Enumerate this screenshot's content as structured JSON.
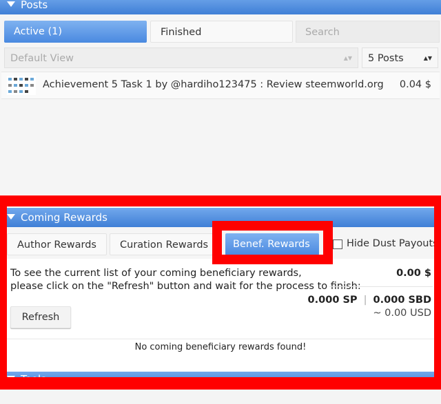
{
  "posts": {
    "header_title": "Posts",
    "tabs": [
      {
        "label": "Active (1)"
      },
      {
        "label": "Finished"
      }
    ],
    "search_placeholder": "Search",
    "view_select": "Default View",
    "count_select": "5 Posts",
    "items": [
      {
        "title": "Achievement 5 Task 1 by @hardiho123475 : Review steemworld.org",
        "value": "0.04 $"
      }
    ]
  },
  "coming_rewards": {
    "header_title": "Coming Rewards",
    "tabs": [
      {
        "label": "Author Rewards"
      },
      {
        "label": "Curation Rewards"
      },
      {
        "label": "Benef. Rewards"
      }
    ],
    "hide_dust_label": "Hide Dust Payouts",
    "info_line1": "To see the current list of your coming beneficiary rewards,",
    "info_line2": "please click on the \"Refresh\" button and wait for the process to finish:",
    "total_usd": "0.00 $",
    "sp_value": "0.000 SP",
    "separator": "|",
    "sbd_value": "0.000 SBD",
    "approx_usd": "~ 0.00 USD",
    "refresh_label": "Refresh",
    "empty_message": "No coming beneficiary rewards found!"
  },
  "next_section": {
    "header_title": "Tools"
  },
  "colors": {
    "highlight": "#ff0000",
    "accent_blue": "#4a89e0"
  }
}
